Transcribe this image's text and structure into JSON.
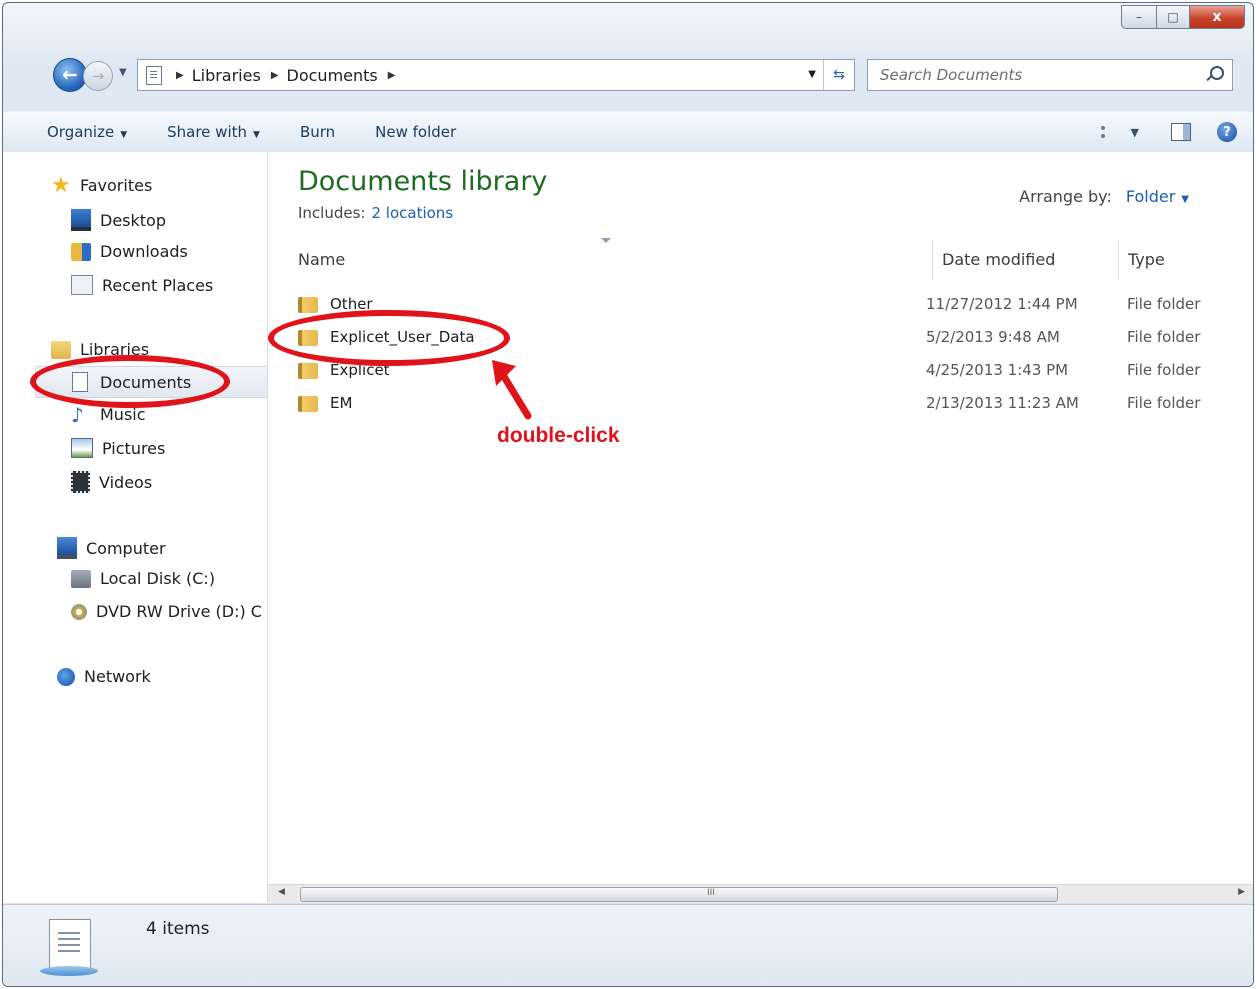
{
  "titlebar": {
    "min_label": "–",
    "max_label": "□",
    "close_label": "x"
  },
  "address": {
    "crumbs": [
      "Libraries",
      "Documents"
    ],
    "search_placeholder": "Search Documents"
  },
  "toolbar": {
    "organize": "Organize",
    "share_with": "Share with",
    "burn": "Burn",
    "new_folder": "New folder"
  },
  "nav": {
    "favorites": "Favorites",
    "desktop": "Desktop",
    "downloads": "Downloads",
    "recent_places": "Recent Places",
    "libraries": "Libraries",
    "documents": "Documents",
    "music": "Music",
    "pictures": "Pictures",
    "videos": "Videos",
    "computer": "Computer",
    "local_disk": "Local Disk (C:)",
    "dvd": "DVD RW Drive (D:) C",
    "network": "Network"
  },
  "library": {
    "title": "Documents library",
    "includes_label": "Includes:",
    "includes_link": "2 locations",
    "arrange_label": "Arrange by:",
    "arrange_value": "Folder"
  },
  "columns": {
    "name": "Name",
    "date": "Date modified",
    "type": "Type"
  },
  "files": [
    {
      "name": "Other",
      "date": "11/27/2012 1:44 PM",
      "type": "File folder"
    },
    {
      "name": "Explicet_User_Data",
      "date": "5/2/2013 9:48 AM",
      "type": "File folder"
    },
    {
      "name": "Explicet",
      "date": "4/25/2013 1:43 PM",
      "type": "File folder"
    },
    {
      "name": "EM",
      "date": "2/13/2013 11:23 AM",
      "type": "File folder"
    }
  ],
  "status": {
    "count": "4 items"
  },
  "annotation": {
    "text": "double-click",
    "color": "#e0121a"
  }
}
